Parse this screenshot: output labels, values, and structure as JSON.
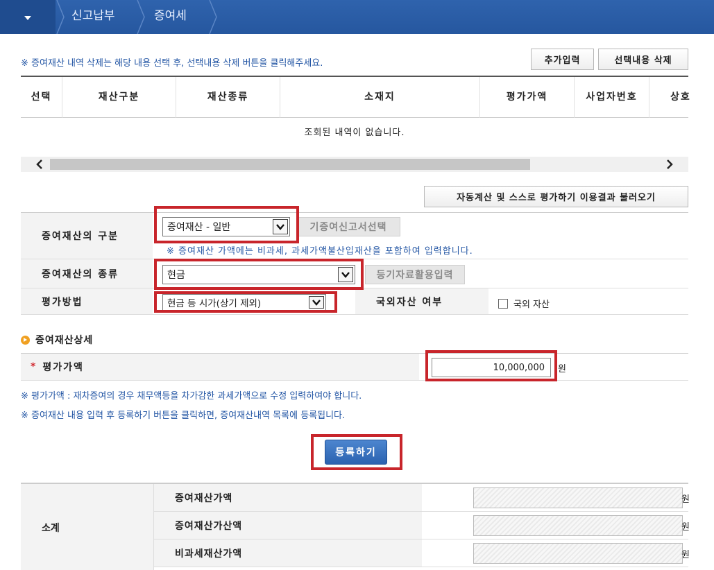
{
  "header": {
    "crumbs": [
      "신고납부",
      "증여세"
    ]
  },
  "notices": {
    "delete_notice": "※ 증여재산 내역 삭제는 해당 내용 선택 후, 선택내용 삭제 버튼을  클릭해주세요.",
    "eval_notice": "※ 평가가액 : 재차증여의 경우 채무액등을 차가감한 과세가액으로 수정 입력하여야 합니다.",
    "register_notice": "※ 증여재산 내용 입력 후 등록하기 버튼을 클릭하면, 증여재산내역 목록에 등록됩니다."
  },
  "buttons": {
    "add_input": "추가입력",
    "delete_selected": "선택내용 삭제",
    "autocalc_load": "자동계산 및 스스로 평가하기 이용결과 불러오기",
    "prior_report": "기증여신고서선택",
    "registry_input": "등기자료활용입력",
    "register": "등록하기"
  },
  "table": {
    "columns": [
      "선택",
      "재산구분",
      "재산종류",
      "소재지",
      "평가가액",
      "사업자번호",
      "상호"
    ],
    "empty_message": "조회된 내역이 없습니다."
  },
  "form": {
    "category_label": "증여재산의 구분",
    "category_value": "증여재산 - 일반",
    "category_hint": "※ 증여재산 가액에는 비과세, 과세가액불산입재산을 포함하여 입력합니다.",
    "type_label": "증여재산의 종류",
    "type_value": "현금",
    "method_label": "평가방법",
    "method_value": "현금 등 시가(상기 제외)",
    "overseas_label": "국외자산 여부",
    "overseas_checkbox": "국외 자산",
    "overseas_checked": false
  },
  "detail": {
    "section_title": "증여재산상세",
    "required_mark": "*",
    "eval_label": "평가가액",
    "eval_value": "10,000,000",
    "unit": "원"
  },
  "summary": {
    "group_label": "소계",
    "rows": [
      {
        "label": "증여재산가액",
        "unit": "원"
      },
      {
        "label": "증여재산가산액",
        "unit": "원"
      },
      {
        "label": "비과세재산가액",
        "unit": "원"
      }
    ]
  },
  "colors": {
    "header_blue": "#2b5ea8",
    "highlight_red": "#c8252b",
    "notice_blue": "#2255a4"
  }
}
